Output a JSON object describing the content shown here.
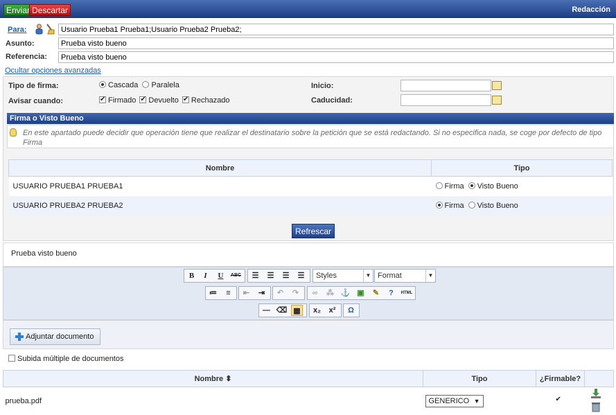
{
  "toolbar": {
    "send_label": "Enviar",
    "discard_label": "Descartar",
    "title": "Redacción"
  },
  "header": {
    "to_label": "Para:",
    "to_value": "Usuario Prueba1 Prueba1;Usuario Prueba2 Prueba2;",
    "subject_label": "Asunto:",
    "subject_value": "Prueba visto bueno",
    "reference_label": "Referencia:",
    "reference_value": "Prueba visto bueno",
    "advanced_link": "Ocultar opciones avanzadas"
  },
  "advanced": {
    "signature_type_label": "Tipo de firma:",
    "signature_options": [
      {
        "label": "Cascada",
        "checked": true
      },
      {
        "label": "Paralela",
        "checked": false
      }
    ],
    "notify_label": "Avisar cuando:",
    "notify_options": [
      {
        "label": "Firmado",
        "checked": true
      },
      {
        "label": "Devuelto",
        "checked": true
      },
      {
        "label": "Rechazado",
        "checked": true
      }
    ],
    "start_label": "Inicio:",
    "start_value": "",
    "expiry_label": "Caducidad:",
    "expiry_value": ""
  },
  "approval": {
    "title": "Firma o Visto Bueno",
    "info": "En este apartado puede decidir que operación tiene que realizar el destinatario sobre la petición que se está redactando. Si no especifica nada, se coge por defecto de tipo Firma",
    "columns": [
      "Nombre",
      "Tipo"
    ],
    "option_sign": "Firma",
    "option_approval": "Visto Bueno",
    "rows": [
      {
        "name": "USUARIO PRUEBA1 PRUEBA1",
        "selected": "Visto Bueno"
      },
      {
        "name": "USUARIO PRUEBA2 PRUEBA2",
        "selected": "Firma"
      }
    ],
    "refresh_label": "Refrescar"
  },
  "editor": {
    "content": "Prueba visto bueno",
    "styles_label": "Styles",
    "format_label": "Format"
  },
  "attachments": {
    "add_label": "Adjuntar documento",
    "multi_upload_label": "Subida múltiple de documentos",
    "multi_upload_checked": false,
    "columns": [
      "Nombre ⬍",
      "Tipo",
      "¿Firmable?"
    ],
    "rows": [
      {
        "name": "prueba.pdf",
        "type": "GENERICO",
        "signable": true
      }
    ]
  }
}
